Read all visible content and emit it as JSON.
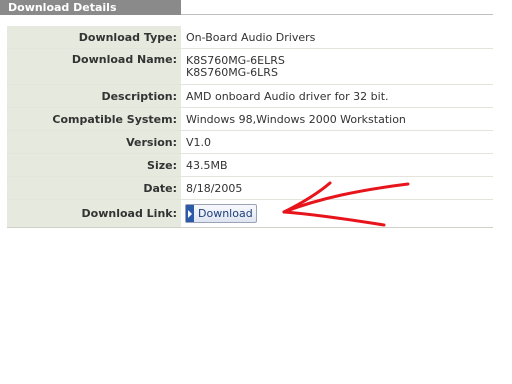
{
  "section_title": "Download Details",
  "rows": [
    {
      "label": "Download Type:",
      "value": "On-Board Audio Drivers"
    },
    {
      "label": "Download Name:",
      "value_lines": [
        "K8S760MG-6ELRS",
        "K8S760MG-6LRS"
      ]
    },
    {
      "label": "Description:",
      "value": "AMD onboard Audio driver for 32 bit."
    },
    {
      "label": "Compatible System:",
      "value": "Windows 98,Windows 2000 Workstation"
    },
    {
      "label": "Version:",
      "value": "V1.0"
    },
    {
      "label": "Size:",
      "value": "43.5MB"
    },
    {
      "label": "Date:",
      "value": "8/18/2005"
    },
    {
      "label": "Download Link:",
      "button_label": "Download"
    }
  ],
  "annotation": {
    "type": "hand-drawn-arrow",
    "color": "#e8141c",
    "points_to": "download-button"
  },
  "icons": {
    "download_button_icon": "arrow-right-icon"
  }
}
